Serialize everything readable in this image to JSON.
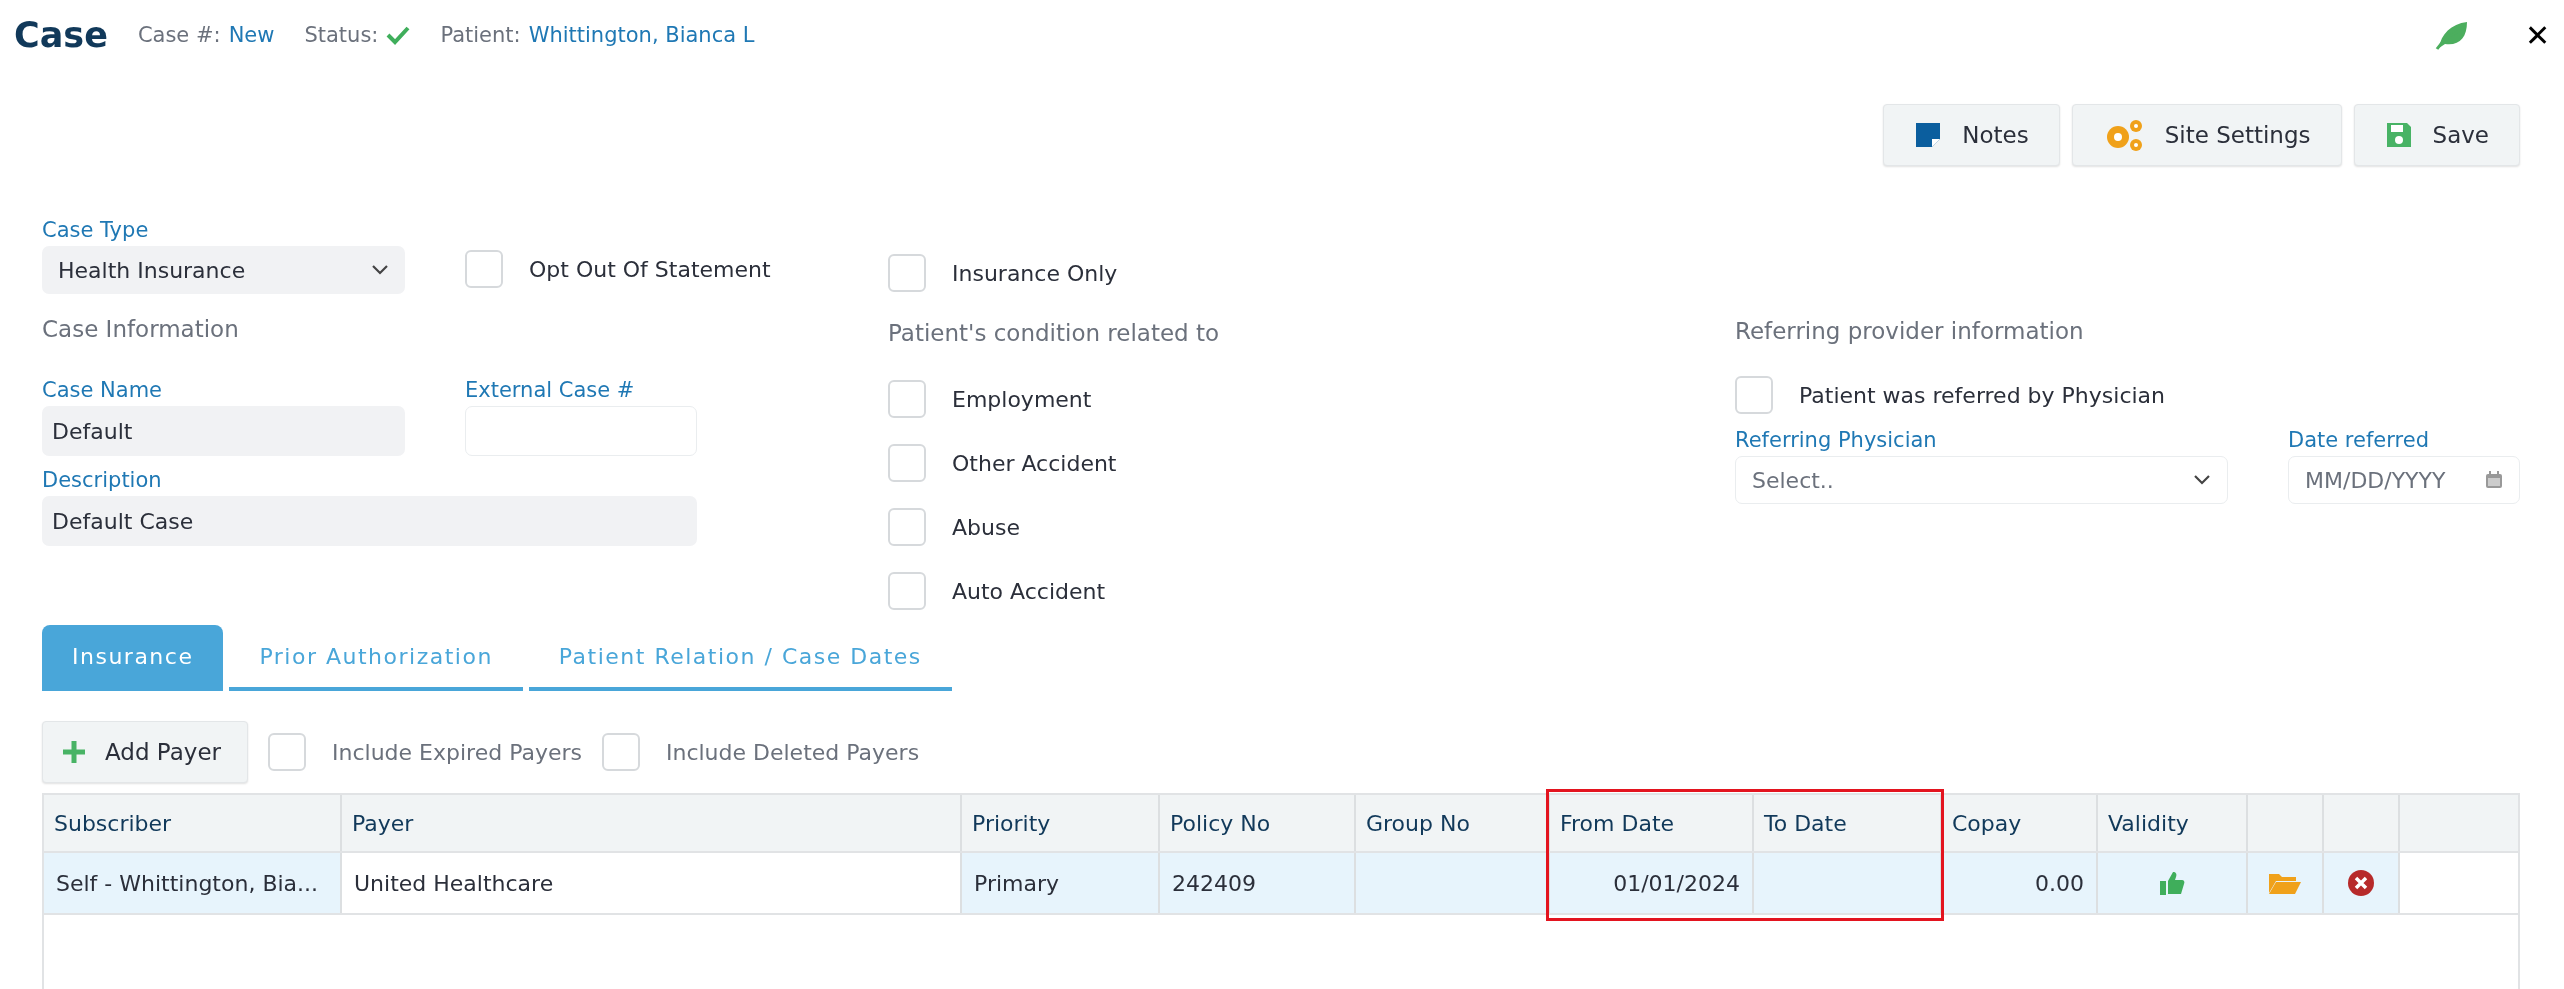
{
  "header": {
    "title": "Case",
    "case_label": "Case #:",
    "case_value": "New",
    "status_label": "Status:",
    "status_ok": true,
    "patient_label": "Patient:",
    "patient_value": "Whittington, Bianca L",
    "close": "✕"
  },
  "toolbar": [
    {
      "kind": "notes",
      "label": "Notes"
    },
    {
      "kind": "settings",
      "label": "Site Settings"
    },
    {
      "kind": "save",
      "label": "Save"
    }
  ],
  "case_type": {
    "label": "Case Type",
    "value": "Health Insurance"
  },
  "opt_out": {
    "label": "Opt Out Of Statement",
    "checked": false
  },
  "insurance_only": {
    "label": "Insurance Only",
    "checked": false
  },
  "case_information": {
    "heading": "Case Information",
    "case_name": {
      "label": "Case Name",
      "value": "Default"
    },
    "external_case": {
      "label": "External Case #"
    },
    "description": {
      "label": "Description",
      "value": "Default Case"
    }
  },
  "condition": {
    "heading": "Patient's condition related to",
    "items": [
      {
        "label": "Employment",
        "checked": false
      },
      {
        "label": "Other Accident",
        "checked": false
      },
      {
        "label": "Abuse",
        "checked": false
      },
      {
        "label": "Auto Accident",
        "checked": false
      }
    ]
  },
  "referring": {
    "heading": "Referring provider information",
    "referred": {
      "label": "Patient was referred by Physician",
      "checked": false
    },
    "physician": {
      "label": "Referring Physician",
      "placeholder": "Select.."
    },
    "date": {
      "label": "Date referred",
      "placeholder": "MM/DD/YYYY"
    }
  },
  "tabs": [
    {
      "label": "Insurance",
      "selected": true
    },
    {
      "label": "Prior Authorization",
      "selected": false
    },
    {
      "label": "Patient Relation / Case Dates",
      "selected": false
    }
  ],
  "payer_bar": {
    "add": "Add Payer",
    "options": [
      {
        "label": "Include Expired Payers",
        "checked": false
      },
      {
        "label": "Include Deleted Payers",
        "checked": false
      }
    ]
  },
  "table": {
    "columns": [
      "Subscriber",
      "Payer",
      "Priority",
      "Policy No",
      "Group No",
      "From Date",
      "To Date",
      "Copay",
      "Validity"
    ],
    "rows": [
      {
        "subscriber": "Self - Whittington, Bia...",
        "payer": "United Healthcare",
        "priority": "Primary",
        "policy_no": "242409",
        "from_date": "01/01/2024",
        "copay": "0.00",
        "valid": true
      }
    ]
  }
}
